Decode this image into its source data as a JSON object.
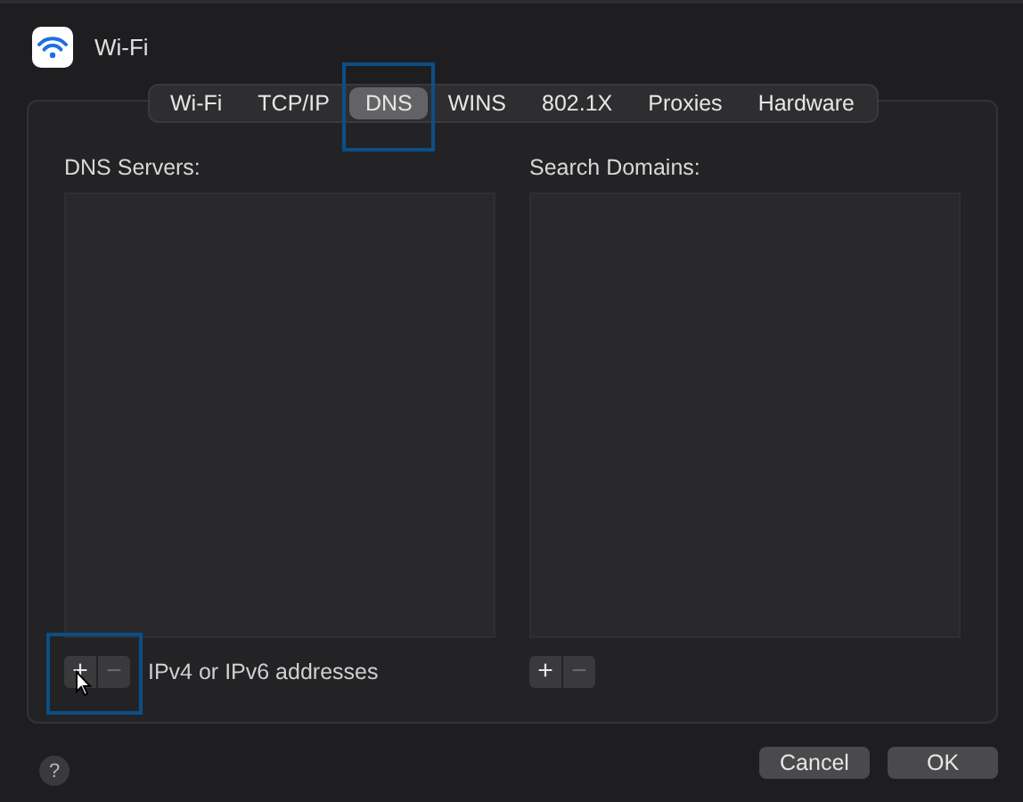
{
  "window": {
    "title": "Wi-Fi"
  },
  "tabs": [
    {
      "label": "Wi-Fi",
      "selected": false,
      "highlighted": false
    },
    {
      "label": "TCP/IP",
      "selected": false,
      "highlighted": false
    },
    {
      "label": "DNS",
      "selected": true,
      "highlighted": true
    },
    {
      "label": "WINS",
      "selected": false,
      "highlighted": false
    },
    {
      "label": "802.1X",
      "selected": false,
      "highlighted": false
    },
    {
      "label": "Proxies",
      "selected": false,
      "highlighted": false
    },
    {
      "label": "Hardware",
      "selected": false,
      "highlighted": false
    }
  ],
  "lists": [
    {
      "label": "DNS Servers:",
      "buttons": [
        {
          "label": "+",
          "disabled": false,
          "highlighted": true
        },
        {
          "label": "−",
          "disabled": true,
          "highlighted": false
        }
      ],
      "hint": "IPv4 or IPv6 addresses"
    },
    {
      "label": "Search Domains:",
      "buttons": [
        {
          "label": "+",
          "disabled": false,
          "highlighted": false
        },
        {
          "label": "−",
          "disabled": true,
          "highlighted": false
        }
      ]
    }
  ],
  "help": "?",
  "buttons": [
    "Cancel",
    "OK"
  ]
}
